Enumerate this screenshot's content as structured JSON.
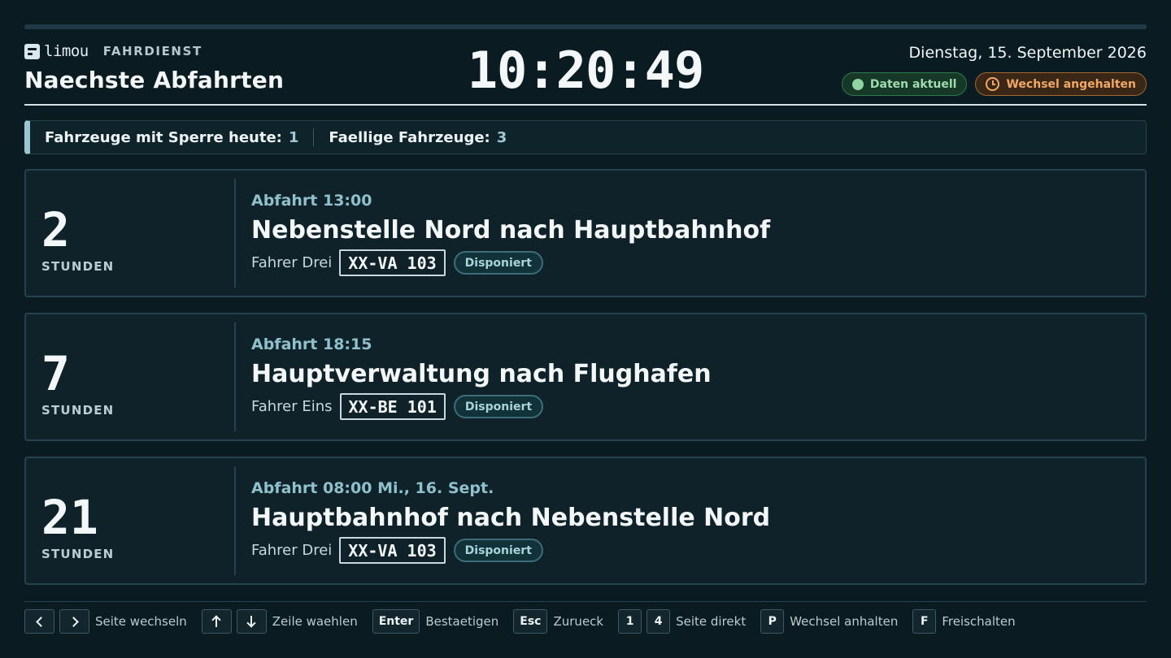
{
  "header": {
    "brand_name": "limou",
    "brand_sub": "FAHRDIENST",
    "title": "Naechste Abfahrten",
    "clock": "10:20:49",
    "date": "Dienstag, 15. September 2026",
    "badge_ok": "Daten aktuell",
    "badge_warn": "Wechsel angehalten"
  },
  "summary": {
    "locked_label": "Fahrzeuge mit Sperre heute:",
    "locked_value": "1",
    "due_label": "Faellige Fahrzeuge:",
    "due_value": "3"
  },
  "departures": [
    {
      "hours": "2",
      "unit": "STUNDEN",
      "departure": "Abfahrt 13:00",
      "route": "Nebenstelle Nord nach Hauptbahnhof",
      "driver": "Fahrer Drei",
      "plate": "XX-VA 103",
      "status": "Disponiert"
    },
    {
      "hours": "7",
      "unit": "STUNDEN",
      "departure": "Abfahrt 18:15",
      "route": "Hauptverwaltung nach Flughafen",
      "driver": "Fahrer Eins",
      "plate": "XX-BE 101",
      "status": "Disponiert"
    },
    {
      "hours": "21",
      "unit": "STUNDEN",
      "departure": "Abfahrt 08:00 Mi., 16. Sept.",
      "route": "Hauptbahnhof nach Nebenstelle Nord",
      "driver": "Fahrer Drei",
      "plate": "XX-VA 103",
      "status": "Disponiert"
    }
  ],
  "footer": {
    "page_label": "Seite wechseln",
    "row_label": "Zeile waehlen",
    "enter_key": "Enter",
    "enter_label": "Bestaetigen",
    "esc_key": "Esc",
    "esc_label": "Zurueck",
    "key_1": "1",
    "key_4": "4",
    "direct_label": "Seite direkt",
    "p_key": "P",
    "p_label": "Wechsel anhalten",
    "f_key": "F",
    "f_label": "Freischalten"
  },
  "icons": [
    "logo-icon",
    "status-dot-icon",
    "clock-icon",
    "chevron-left-icon",
    "chevron-right-icon",
    "arrow-up-icon",
    "arrow-down-icon"
  ]
}
